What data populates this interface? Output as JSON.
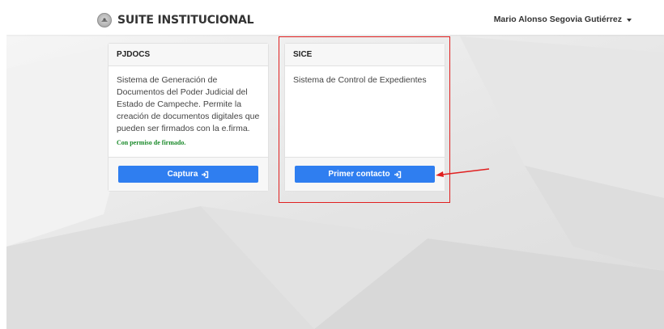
{
  "navbar": {
    "brand_title": "SUITE INSTITUCIONAL",
    "user_name": "Mario Alonso Segovia Gutiérrez"
  },
  "cards": [
    {
      "header": "PJDOCS",
      "description": "Sistema de Generación de Documentos del Poder Judicial del Estado de Campeche. Permite la creación de documentos digitales que pueden ser firmados con la e.firma.",
      "permission": "Con permiso de firmado.",
      "button_label": "Captura"
    },
    {
      "header": "SICE",
      "description": "Sistema de Control de Expedientes",
      "button_label": "Primer contacto"
    }
  ],
  "colors": {
    "primary_button": "#2f7ef0",
    "permission_text": "#1a8a2a",
    "annotation": "#e02020"
  },
  "icons": {
    "brand": "seal-icon",
    "user_menu": "caret-down-icon",
    "button": "sign-in-icon"
  }
}
